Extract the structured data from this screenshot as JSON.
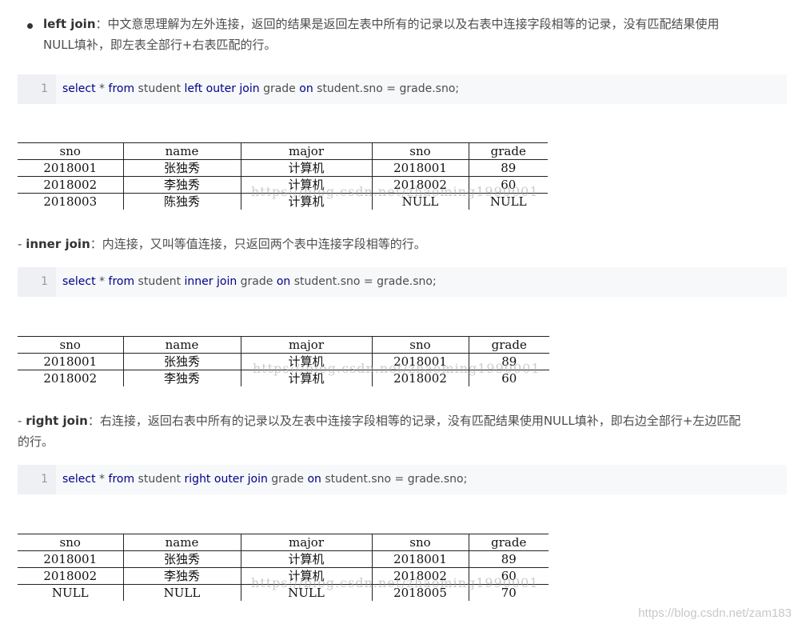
{
  "sections": [
    {
      "heading_prefix": "",
      "title": "left join",
      "desc_line1": "：中文意思理解为左外连接，返回的结果是返回左表中所有的记录以及右表中连接字段相等的记录，没有匹配结果使用",
      "desc_line2": "NULL填补，即左表全部行+右表匹配的行。",
      "code": {
        "line_number": "1",
        "tokens": [
          "select",
          " * ",
          "from",
          " student ",
          "left outer join",
          " grade ",
          "on",
          " student.sno = grade.sno;"
        ]
      },
      "table": {
        "headers": [
          "sno",
          "name",
          "major",
          "sno",
          "grade"
        ],
        "rows": [
          [
            "2018001",
            "张独秀",
            "计算机",
            "2018001",
            "89"
          ],
          [
            "2018002",
            "李独秀",
            "计算机",
            "2018002",
            "60"
          ],
          [
            "2018003",
            "陈独秀",
            "计算机",
            "NULL",
            "NULL"
          ]
        ],
        "watermark": "https://blog.csdn.net/zhaoming1990001"
      }
    },
    {
      "heading_prefix": "- ",
      "title": "inner join",
      "desc_line1": "：内连接，又叫等值连接，只返回两个表中连接字段相等的行。",
      "desc_line2": "",
      "code": {
        "line_number": "1",
        "tokens": [
          "select",
          " * ",
          "from",
          " student ",
          "inner join",
          " grade ",
          "on",
          " student.sno = grade.sno;"
        ]
      },
      "table": {
        "headers": [
          "sno",
          "name",
          "major",
          "sno",
          "grade"
        ],
        "rows": [
          [
            "2018001",
            "张独秀",
            "计算机",
            "2018001",
            "89"
          ],
          [
            "2018002",
            "李独秀",
            "计算机",
            "2018002",
            "60"
          ]
        ],
        "watermark": "https://blog.csdn.net/zhaoming1990001"
      }
    },
    {
      "heading_prefix": "- ",
      "title": "right join",
      "desc_line1": "：右连接，返回右表中所有的记录以及左表中连接字段相等的记录，没有匹配结果使用NULL填补，即右边全部行+左边匹配",
      "desc_line2": "的行。",
      "code": {
        "line_number": "1",
        "tokens": [
          "select",
          " * ",
          "from",
          " student ",
          "right outer join",
          " grade ",
          "on",
          " student.sno = grade.sno;"
        ]
      },
      "table": {
        "headers": [
          "sno",
          "name",
          "major",
          "sno",
          "grade"
        ],
        "rows": [
          [
            "2018001",
            "张独秀",
            "计算机",
            "2018001",
            "89"
          ],
          [
            "2018002",
            "李独秀",
            "计算机",
            "2018002",
            "60"
          ],
          [
            "NULL",
            "NULL",
            "NULL",
            "2018005",
            "70"
          ]
        ],
        "watermark": "https://blog.csdn.net/zhaoming1990001"
      }
    }
  ],
  "page_watermark": "https://blog.csdn.net/zam183",
  "colors": {
    "keyword": "#000088",
    "code_background": "#f6f8fa",
    "text": "#4d4d4d"
  }
}
